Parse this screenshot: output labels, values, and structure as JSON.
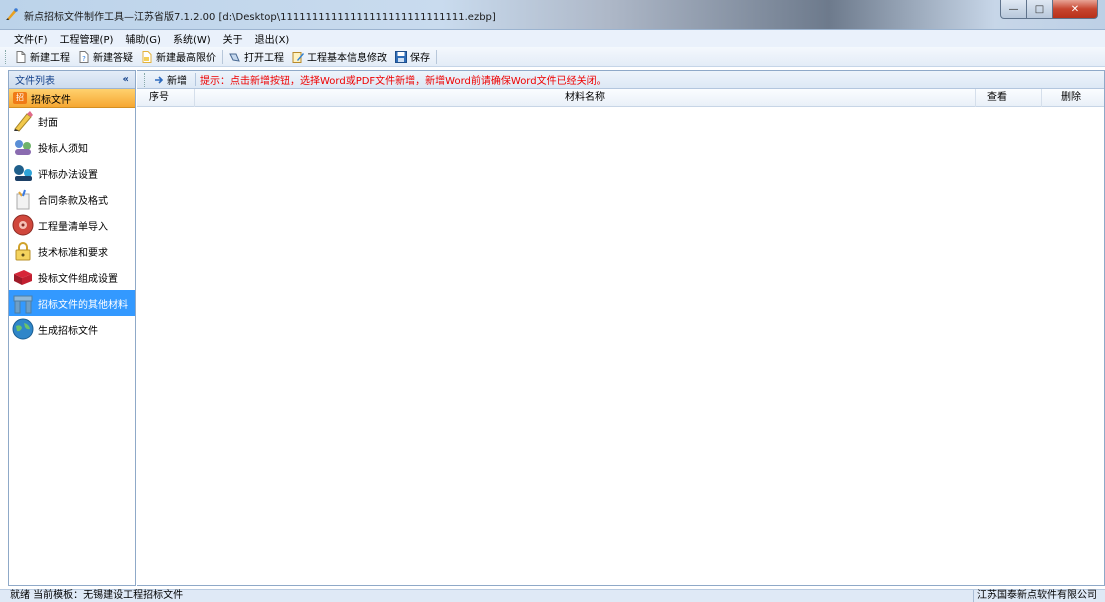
{
  "window": {
    "title": "新点招标文件制作工具—江苏省版7.1.2.00    [d:\\Desktop\\11111111111111111111111111111.ezbp]",
    "minimize": "—",
    "maximize": "□",
    "close": "✕"
  },
  "menu": [
    "文件(F)",
    "工程管理(P)",
    "辅助(G)",
    "系统(W)",
    "关于",
    "退出(X)"
  ],
  "toolbar": {
    "new_project": "新建工程",
    "new_qa": "新建答疑",
    "new_max_price": "新建最高限价",
    "open_project": "打开工程",
    "edit_info": "工程基本信息修改",
    "save": "保存"
  },
  "sidebar": {
    "header": "文件列表",
    "collapse": "«",
    "group": "招标文件",
    "group_icon": "招",
    "items": [
      {
        "label": "封面",
        "icon": "pencil-icon"
      },
      {
        "label": "投标人须知",
        "icon": "people-icon"
      },
      {
        "label": "评标办法设置",
        "icon": "reviewers-icon"
      },
      {
        "label": "合同条款及格式",
        "icon": "document-icon"
      },
      {
        "label": "工程量清单导入",
        "icon": "disc-icon"
      },
      {
        "label": "技术标准和要求",
        "icon": "lock-icon"
      },
      {
        "label": "投标文件组成设置",
        "icon": "book-icon"
      },
      {
        "label": "招标文件的其他材料",
        "icon": "folder-icon"
      },
      {
        "label": "生成招标文件",
        "icon": "globe-icon"
      }
    ],
    "selected_index": 7
  },
  "main": {
    "add_button": "新增",
    "hint": "提示：点击新增按钮，选择Word或PDF文件新增，新增Word前请确保Word文件已经关闭。",
    "columns": [
      "序号",
      "材料名称",
      "查看",
      "删除"
    ]
  },
  "status": {
    "left": "就绪  当前模板：无锡建设工程招标文件",
    "right": "江苏国泰新点软件有限公司"
  },
  "colors": {
    "selected": "#3399ff",
    "hint": "#e00000",
    "group": "#f6a732"
  }
}
